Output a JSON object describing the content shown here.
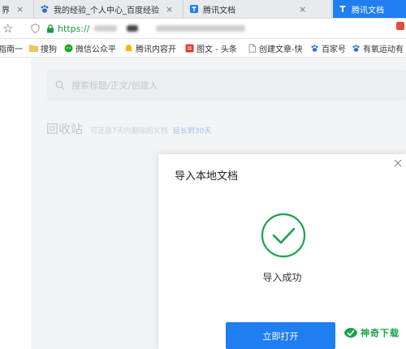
{
  "tabs": [
    {
      "label": "界",
      "icon": "close-icon"
    },
    {
      "label": "我的经验_个人中心_百度经验",
      "icon": "baidu-paw-icon"
    },
    {
      "label": "腾讯文档",
      "icon": "tencent-docs-icon"
    },
    {
      "label": "腾讯文档",
      "icon": "tencent-docs-icon",
      "active": true
    }
  ],
  "tab_close": "×",
  "address": {
    "url_prefix": "https://"
  },
  "bookmarks": [
    {
      "label": "指南一",
      "icon": "none"
    },
    {
      "label": "搜狗",
      "icon": "folder-icon"
    },
    {
      "label": "微信公众平",
      "icon": "wechat-icon"
    },
    {
      "label": "腾讯内容开",
      "icon": "tencent-bell-icon"
    },
    {
      "label": "图文 - 头条",
      "icon": "toutiao-icon"
    },
    {
      "label": "创建文章-快",
      "icon": "page-icon"
    },
    {
      "label": "百家号",
      "icon": "baidu-paw-icon"
    },
    {
      "label": "有氧运动有",
      "icon": "baidu-paw-icon"
    }
  ],
  "search": {
    "placeholder": "搜索标题/正文/创建人"
  },
  "recycle": {
    "title": "回收站",
    "note": "可还原7天内删除的文档",
    "extend_link": "延长到30天"
  },
  "dialog": {
    "title": "导入本地文档",
    "message": "导入成功",
    "open_button": "立即打开"
  },
  "watermark": {
    "text": "神奇下载"
  },
  "colors": {
    "accent": "#1f7ef0",
    "success": "#1aa34a",
    "url_green": "#1a9b3c"
  }
}
